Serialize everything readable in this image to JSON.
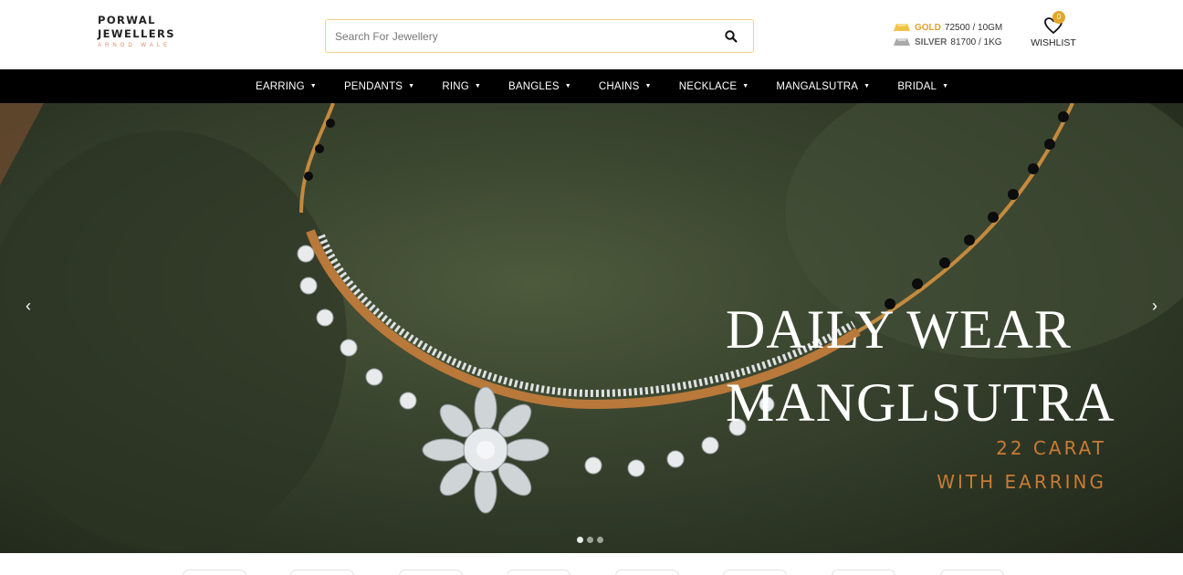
{
  "header": {
    "logo": {
      "line1": "PORWAL",
      "line2": "JEWELLERS",
      "tagline": "ARNOD WALE"
    },
    "search": {
      "placeholder": "Search For Jewellery"
    },
    "rates": {
      "gold": {
        "name": "GOLD",
        "value": "72500 / 10GM"
      },
      "silver": {
        "name": "SILVER",
        "value": "81700 / 1KG"
      }
    },
    "wishlist": {
      "label": "WISHLIST",
      "count": "0"
    }
  },
  "nav": {
    "items": [
      {
        "label": "EARRING"
      },
      {
        "label": "PENDANTS"
      },
      {
        "label": "RING"
      },
      {
        "label": "BANGLES"
      },
      {
        "label": "CHAINS"
      },
      {
        "label": "NECKLACE"
      },
      {
        "label": "MANGALSUTRA"
      },
      {
        "label": "BRIDAL"
      }
    ]
  },
  "hero": {
    "title_line1": "DAILY WEAR",
    "title_line2": "MANGLSUTRA",
    "sub_line1": "22 CARAT",
    "sub_line2": "WITH EARRING",
    "prev_icon": "‹",
    "next_icon": "›",
    "slides": 3,
    "active_slide": 1
  },
  "colors": {
    "accent_gold": "#e0a02a",
    "subtitle_copper": "#c97b35",
    "nav_bg": "#000000",
    "search_border": "#f0d38a"
  }
}
